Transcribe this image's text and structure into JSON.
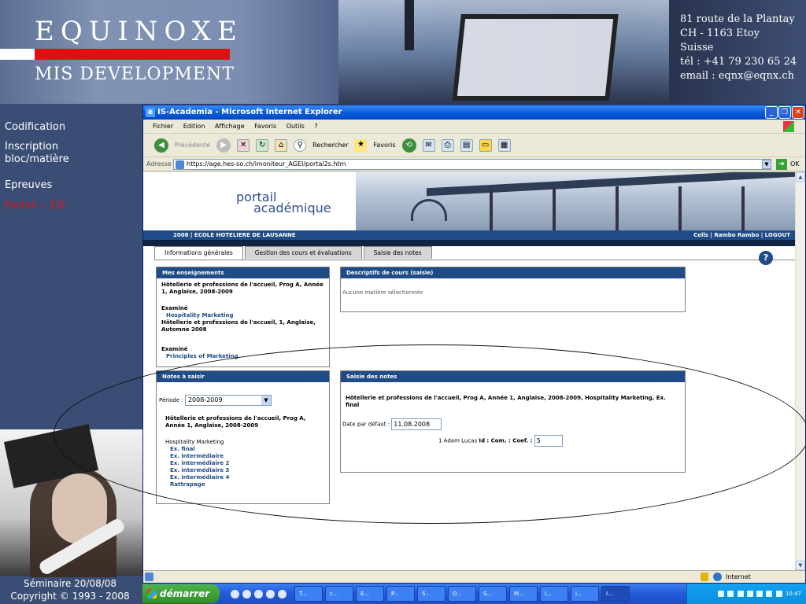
{
  "brand": {
    "name": "EQUINOXE",
    "sub": "MIS DEVELOPMENT"
  },
  "address": [
    "81 route de la Plantay",
    "CH - 1163 Etoy",
    "Suisse",
    "tél : +41 79 230 65 24",
    "email : eqnx@eqnx.ch"
  ],
  "leftnav": {
    "items": [
      {
        "label": "Codification",
        "active": false
      },
      {
        "label": "Inscription bloc/matière",
        "active": false
      },
      {
        "label": "Epreuves",
        "active": false
      },
      {
        "label": "Portail – 3/6",
        "active": true
      }
    ]
  },
  "footer": {
    "line1": "Séminaire 20/08/08",
    "line2": "Copyright © 1993 - 2008"
  },
  "ie": {
    "title": "IS-Academia - Microsoft Internet Explorer",
    "menu": [
      "Fichier",
      "Edition",
      "Affichage",
      "Favoris",
      "Outils",
      "?"
    ],
    "toolbar": {
      "back": "Précédente",
      "search": "Rechercher",
      "favorites": "Favoris"
    },
    "address_label": "Adresse",
    "url": "https://age.hes-so.ch/imoniteur_AGEI/portal2s.htm",
    "ok": "OK",
    "status_zone": "Internet"
  },
  "portal": {
    "word1": "portail",
    "word2": "académique",
    "school": "2008 | ECOLE HOTELIERE DE LAUSANNE",
    "user_links": "Cells | Rambo Rambo | LOGOUT",
    "tabs": [
      "Informations générales",
      "Gestion des cours et évaluations",
      "Saisie des notes"
    ],
    "help": "?",
    "mes_enseignements": {
      "title": "Mes enseignements",
      "course1": "Hôtellerie et professions de l'accueil, Prog A, Année 1, Anglaise, 2008-2009",
      "label1": "Examiné",
      "link1": "Hospitality Marketing",
      "course2": "Hôtellerie et professions de l'accueil, 1, Anglaise, Automne 2008",
      "label2": "Examiné",
      "link2": "Principles of Marketing"
    },
    "descriptifs": {
      "title": "Descriptifs de cours (saisie)",
      "empty": "Aucune matière sélectionnée"
    },
    "notes_a_saisir": {
      "title": "Notes à saisir",
      "periode_label": "Période :",
      "periode_value": "2008-2009",
      "course": "Hôtellerie et professions de l'accueil, Prog A, Année 1, Anglaise, 2008-2009",
      "subject": "Hospitality Marketing",
      "exams": [
        "Ex. final",
        "Ex. intermédiaire",
        "Ex. intermédiaire 2",
        "Ex. intermédiaire 3",
        "Ex. intermédiaire 4",
        "Rattrapage"
      ]
    },
    "saisie": {
      "title": "Saisie des notes",
      "heading": "Hôtellerie et professions de l'accueil, Prog A, Année 1, Anglaise, 2008-2009, Hospitality Marketing, Ex. final",
      "date_label": "Date par défaut :",
      "date_value": "11.08.2008",
      "row_label": "1 Adam Lucas",
      "row_fields": "Id : Com. : Coef. :",
      "coef_value": "5"
    }
  },
  "taskbar": {
    "start": "démarrer",
    "tasks": [
      "T...",
      "c...",
      "E...",
      "P...",
      "S...",
      "O...",
      "S...",
      "M...",
      "I...",
      "I...",
      "I..."
    ],
    "time": "10:47"
  }
}
